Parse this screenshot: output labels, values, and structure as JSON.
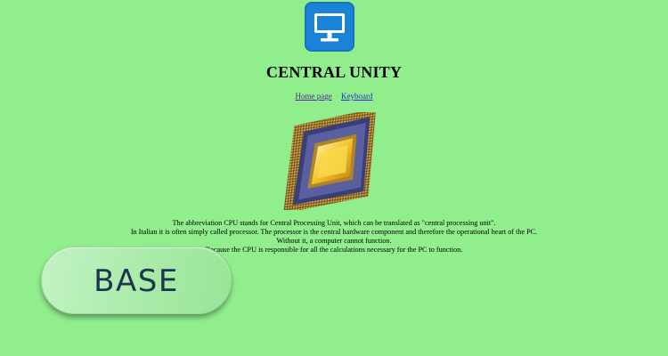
{
  "logo": {
    "icon": "monitor-icon",
    "color": "#1b83d6"
  },
  "page": {
    "title": "CENTRAL UNITY"
  },
  "nav": {
    "home_label": "Home page",
    "keyboard_label": "Keyboard"
  },
  "image": {
    "icon": "cpu-chip-image"
  },
  "description": {
    "lines": [
      "The abbreviation CPU stands for Central Processing Unit, which can be translated as \"central processing unit\".",
      "In Italian it is often simply called processor. The processor is the central hardware component and therefore the operational heart of the PC.",
      "Without it, a computer cannot function.",
      "Because the CPU is responsible for all the calculations necessary for the PC to function."
    ]
  },
  "base_button": {
    "label": "BASE"
  },
  "colors": {
    "background": "#90ee8d",
    "button_text": "#1e3550"
  }
}
